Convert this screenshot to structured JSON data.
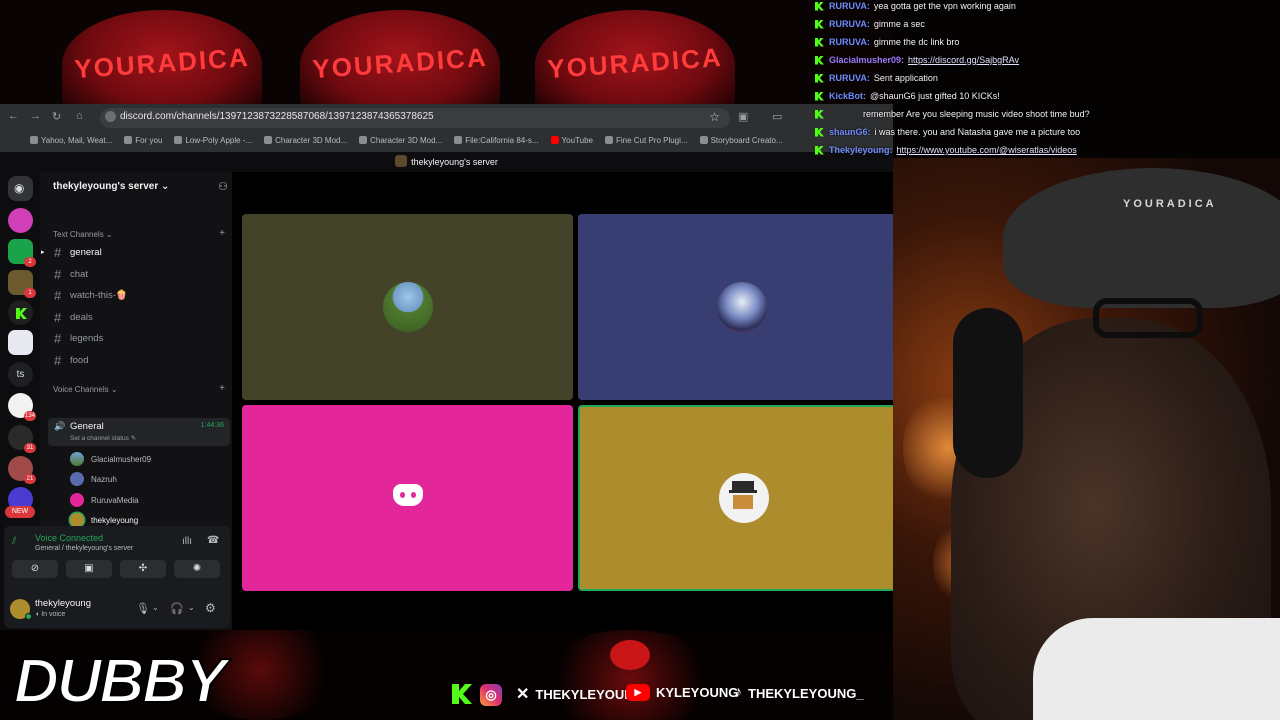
{
  "banner": {
    "badge_text": "YOURADICA"
  },
  "browser": {
    "url": "discord.com/channels/1397123873228587068/1397123874365378625",
    "bookmarks": [
      "Yahoo, Mail, Weat...",
      "For you",
      "Low-Poly Apple -...",
      "Character 3D Mod...",
      "Character 3D Mod...",
      "File:California 84-s...",
      "YouTube",
      "Fine Cut Pro Plugi...",
      "Storyboard Creato..."
    ]
  },
  "discord": {
    "window_title": "thekyleyoung's server",
    "server_name": "thekyleyoung's server",
    "guild_badges": [
      "2",
      "1",
      "134",
      "31",
      "21",
      "NEW"
    ],
    "guild_ts": "ts",
    "text_category": "Text Channels",
    "text_channels": [
      "general",
      "chat",
      "watch-this-🍿",
      "deals",
      "legends",
      "food"
    ],
    "voice_category": "Voice Channels",
    "voice_channel": {
      "name": "General",
      "time": "1:44:36",
      "status": "Set a channel status"
    },
    "members": [
      "Glacialmusher09",
      "Nazruh",
      "RuruvaMedia",
      "thekyleyoung"
    ],
    "voice_panel": {
      "title": "Voice Connected",
      "subtitle": "General / thekyleyoung's server"
    },
    "user": {
      "name": "thekyleyoung",
      "status": "In voice"
    }
  },
  "chat": [
    {
      "user": "RURUVA",
      "text": "yea gotta get the vpn working again",
      "color": "#6f8cff"
    },
    {
      "user": "RURUVA",
      "text": "gimme a sec",
      "color": "#6f8cff"
    },
    {
      "user": "RURUVA",
      "text": "gimme the dc link bro",
      "color": "#6f8cff"
    },
    {
      "user": "Glacialmusher09",
      "text": "https://discord.gg/SajbgRAv",
      "color": "#9b7cff",
      "link": true
    },
    {
      "user": "RURUVA",
      "text": "Sent application",
      "color": "#6f8cff"
    },
    {
      "user": "KickBot",
      "text": "@shaunG6 just gifted 10 KICKs!",
      "color": "#6f8cff"
    },
    {
      "user": "",
      "text": "remember Are you sleeping music video shoot time bud?",
      "color": "#6f8cff"
    },
    {
      "user": "shaunG6",
      "text": "i was there. you and Natasha gave me a picture too",
      "color": "#6f8cff"
    },
    {
      "user": "Thekyleyoung",
      "text": "https://www.youtube.com/@wiseratlas/videos",
      "color": "#6f8cff",
      "link": true
    }
  ],
  "overlay": {
    "brand": "DUBBY",
    "socials": [
      "THEKYLEYOUNG",
      "KYLEYOUNG",
      "THEKYLEYOUNG_"
    ]
  },
  "colors": {
    "tile_1": "#43432a",
    "tile_2": "#383e72",
    "tile_3": "#e3279a",
    "tile_4": "#ad8c2d",
    "kick_green": "#53fc18",
    "voice_green": "#23a55a"
  }
}
